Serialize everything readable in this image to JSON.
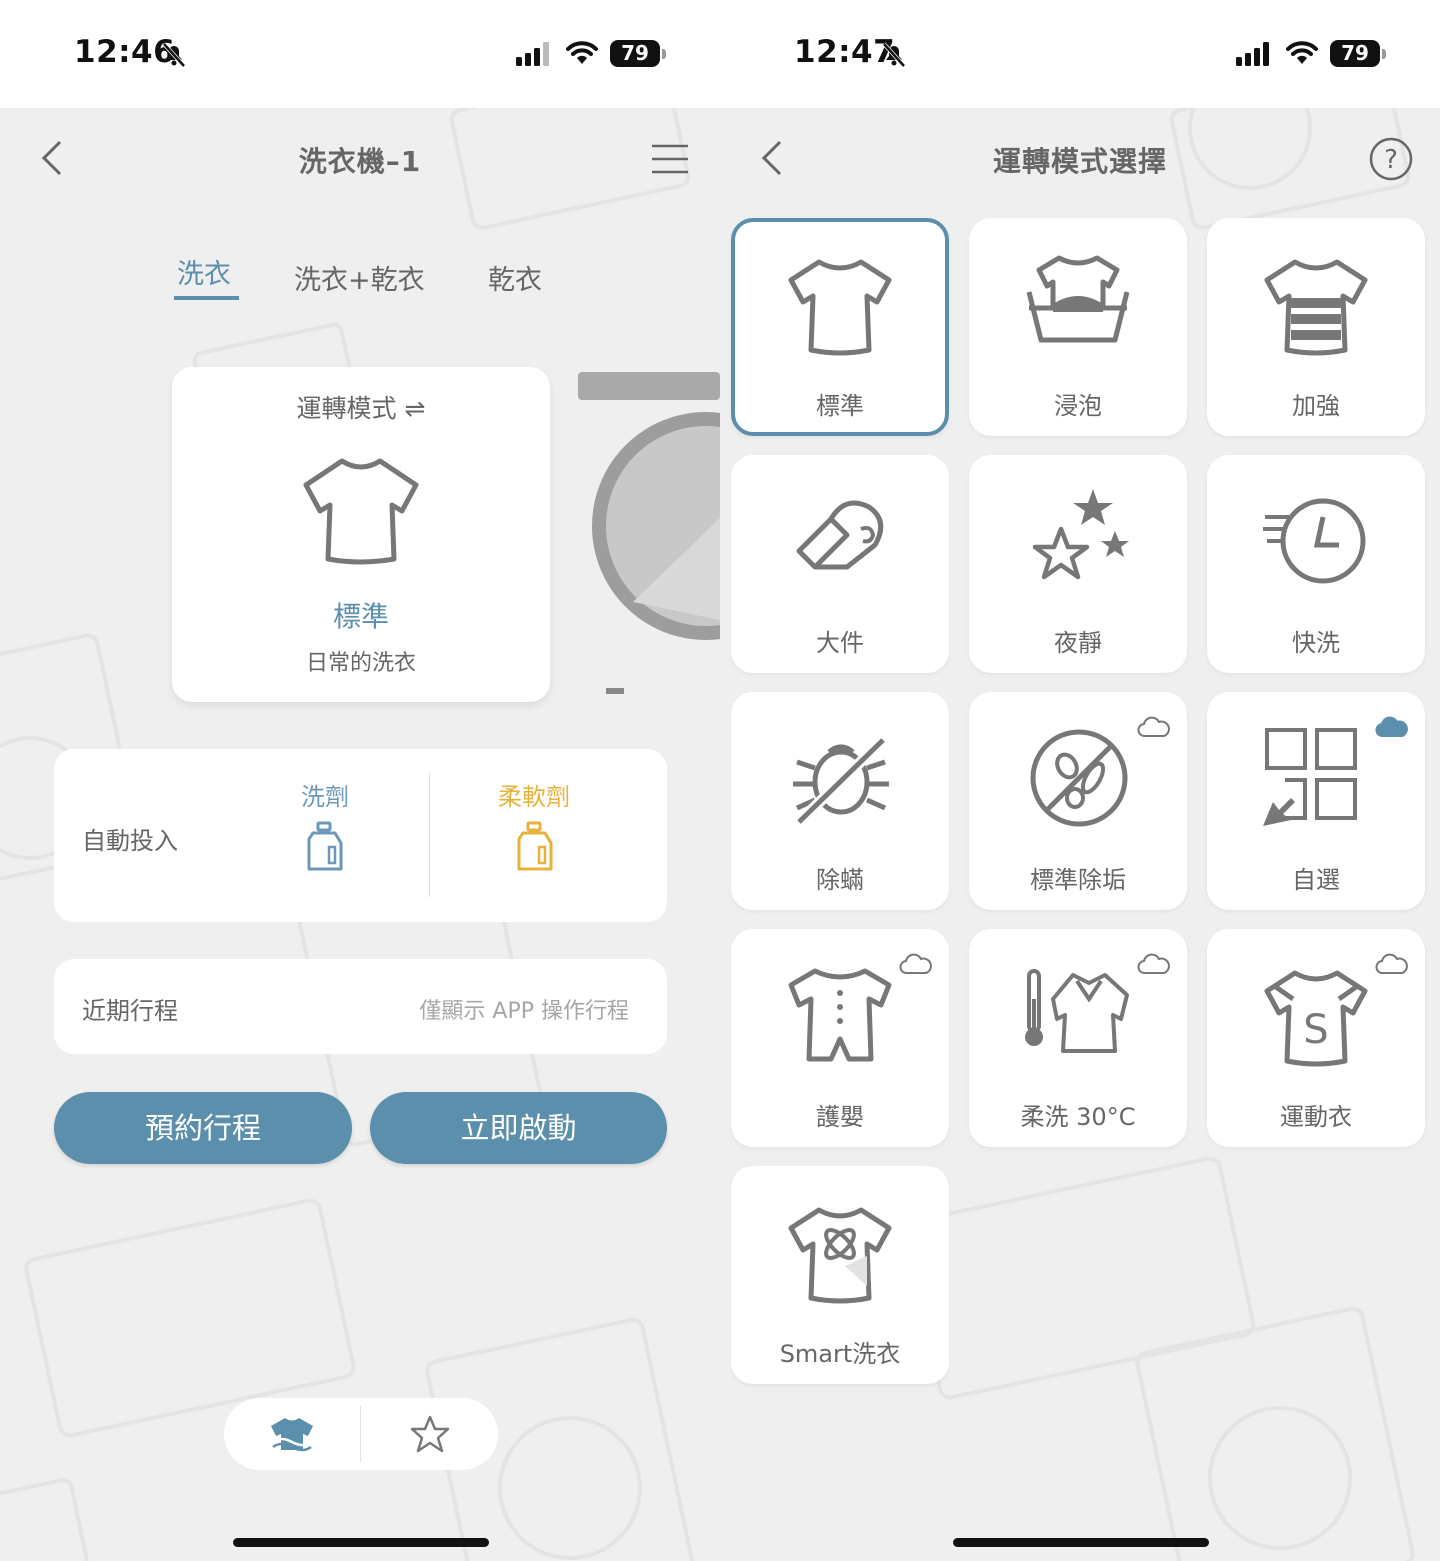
{
  "left": {
    "status": {
      "time": "12:46",
      "battery": "79"
    },
    "title": "洗衣機–1",
    "tabs": [
      "洗衣",
      "洗衣+乾衣",
      "乾衣"
    ],
    "active_tab": 0,
    "mode_card": {
      "label": "運轉模式 ⇌",
      "mode_name": "標準",
      "mode_desc": "日常的洗衣"
    },
    "auto_dispense": {
      "label": "自動投入",
      "detergent": "洗劑",
      "softener": "柔軟劑"
    },
    "recent": {
      "label": "近期行程",
      "hint": "僅顯示 APP 操作行程"
    },
    "buttons": {
      "schedule": "預約行程",
      "start": "立即啟動"
    }
  },
  "right": {
    "status": {
      "time": "12:47",
      "battery": "79"
    },
    "title": "運轉模式選擇",
    "modes": [
      {
        "label": "標準",
        "icon": "shirt-icon",
        "cloud": false,
        "selected": true
      },
      {
        "label": "浸泡",
        "icon": "soak-icon",
        "cloud": false,
        "selected": false
      },
      {
        "label": "加強",
        "icon": "heavy-shirt-icon",
        "cloud": false,
        "selected": false
      },
      {
        "label": "大件",
        "icon": "towel-roll-icon",
        "cloud": false,
        "selected": false
      },
      {
        "label": "夜靜",
        "icon": "stars-icon",
        "cloud": false,
        "selected": false
      },
      {
        "label": "快洗",
        "icon": "fast-clock-icon",
        "cloud": false,
        "selected": false
      },
      {
        "label": "除蟎",
        "icon": "no-mite-icon",
        "cloud": false,
        "selected": false
      },
      {
        "label": "標準除垢",
        "icon": "germ-icon",
        "cloud": true,
        "selected": false
      },
      {
        "label": "自選",
        "icon": "custom-grid-icon",
        "cloud": true,
        "cloud_filled": true,
        "selected": false
      },
      {
        "label": "護嬰",
        "icon": "baby-romper-icon",
        "cloud": true,
        "selected": false
      },
      {
        "label": "柔洗 30°C",
        "icon": "thermometer-shirt-icon",
        "cloud": true,
        "selected": false
      },
      {
        "label": "運動衣",
        "icon": "sport-shirt-icon",
        "cloud": true,
        "selected": false
      },
      {
        "label": "Smart洗衣",
        "icon": "smart-shirt-icon",
        "cloud": false,
        "selected": false
      }
    ]
  },
  "colors": {
    "accent": "#5b8fab",
    "detergent": "#6d98b8",
    "softener": "#e8b23a",
    "background": "#efefef",
    "icon_gray": "#777777"
  }
}
